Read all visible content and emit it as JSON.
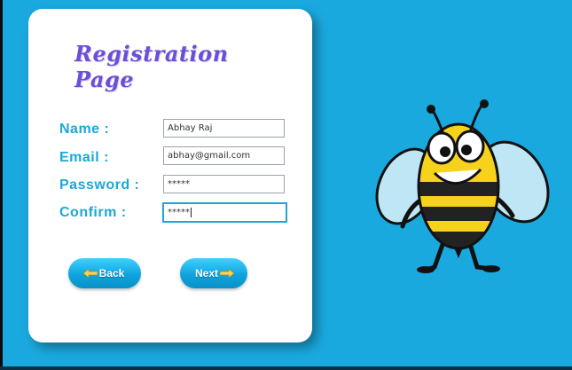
{
  "page": {
    "title": "Registration Page"
  },
  "form": {
    "name_label": "Name :",
    "name_value": "Abhay Raj",
    "email_label": "Email :",
    "email_value": "abhay@gmail.com",
    "password_label": "Password :",
    "password_value": "*****",
    "confirm_label": "Confirm :",
    "confirm_value": "*****"
  },
  "buttons": {
    "back_label": "Back",
    "next_label": "Next"
  },
  "colors": {
    "background": "#1aa9de",
    "accent": "#1aa9d6",
    "title": "#6b4fd6"
  },
  "icons": {
    "back": "left-arrow-icon",
    "next": "right-arrow-icon",
    "mascot": "bee-icon"
  }
}
